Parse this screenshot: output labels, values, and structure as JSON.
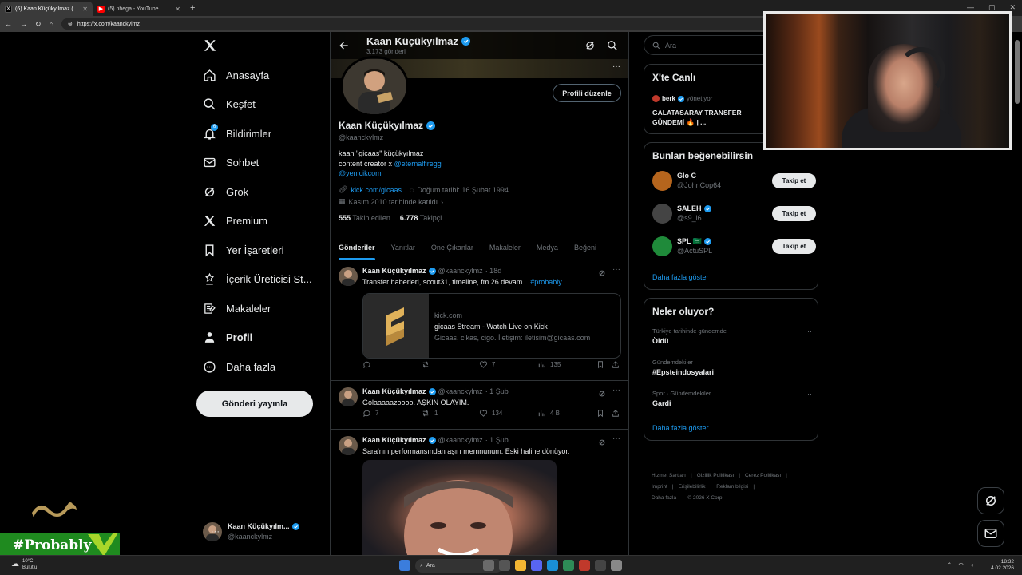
{
  "browser": {
    "tabs": [
      {
        "title": "(6) Kaan Küçükyılmaz (@kaanckylmz) / X",
        "fav": "X",
        "color": "#000000",
        "active": true
      },
      {
        "title": "(5) nhega - YouTube",
        "fav": "▶",
        "color": "#ff0000",
        "active": false
      }
    ],
    "url": "https://x.com/kaanckylmz"
  },
  "nav": {
    "items": [
      {
        "label": "Anasayfa",
        "icon": "home-icon"
      },
      {
        "label": "Keşfet",
        "icon": "search-icon"
      },
      {
        "label": "Bildirimler",
        "icon": "bell-icon",
        "badge": "6"
      },
      {
        "label": "Sohbet",
        "icon": "mail-icon"
      },
      {
        "label": "Grok",
        "icon": "grok-icon"
      },
      {
        "label": "Premium",
        "icon": "x-icon"
      },
      {
        "label": "Yer İşaretleri",
        "icon": "bookmark-icon"
      },
      {
        "label": "İçerik Üreticisi St...",
        "icon": "creator-icon"
      },
      {
        "label": "Makaleler",
        "icon": "articles-icon"
      },
      {
        "label": "Profil",
        "icon": "profile-icon"
      },
      {
        "label": "Daha fazla",
        "icon": "more-circle-icon"
      }
    ],
    "post_button": "Gönderi yayınla",
    "account": {
      "name": "Kaan Küçükyılm...",
      "handle": "@kaanckylmz"
    }
  },
  "profile": {
    "header_name": "Kaan Küçükyılmaz",
    "post_count": "3.173 gönderi",
    "edit_button": "Profili düzenle",
    "name": "Kaan Küçükyılmaz",
    "handle": "@kaanckylmz",
    "bio_line1": "kaan \"gicaas\" küçükyılmaz",
    "bio_line2_prefix": "content creator x ",
    "bio_link1": "@eternalfiregg",
    "bio_link2": "@yenicikcom",
    "website": "kick.com/gicaas",
    "birthday": "Doğum tarihi: 16 Şubat 1994",
    "joined": "Kasım 2010 tarihinde katıldı",
    "following_count": "555",
    "following_label": "Takip edilen",
    "followers_count": "6.778",
    "followers_label": "Takipçi",
    "tabs": [
      "Gönderiler",
      "Yanıtlar",
      "Öne Çıkanlar",
      "Makaleler",
      "Medya",
      "Beğeni"
    ]
  },
  "posts": [
    {
      "name": "Kaan Küçükyılmaz",
      "handle": "@kaanckylmz",
      "time": "· 18d",
      "text": "Transfer haberleri, scout31, timeline, fm 26 devam...",
      "hashtag": "#probably",
      "card": {
        "domain": "kick.com",
        "title": "gicaas Stream - Watch Live on Kick",
        "desc": "Gicaas, cikas, cigo. İletişim: iletisim@gicaas.com"
      },
      "replies": "",
      "reposts": "",
      "likes": "7",
      "views": "135"
    },
    {
      "name": "Kaan Küçükyılmaz",
      "handle": "@kaanckylmz",
      "time": "· 1 Şub",
      "text": "Golaaaaazoooo. AŞKIN OLAYIM.",
      "replies": "7",
      "reposts": "1",
      "likes": "134",
      "views": "4 B"
    },
    {
      "name": "Kaan Küçükyılmaz",
      "handle": "@kaanckylmz",
      "time": "· 1 Şub",
      "text": "Sara'nın performansından aşırı memnunum. Eski haline dönüyor."
    }
  ],
  "sidebar": {
    "search_placeholder": "Ara",
    "live": {
      "title": "X'te Canlı",
      "host": "berk",
      "host_suffix": "yönetiyor",
      "stream_title": "GALATASARAY TRANSFER GÜNDEMİ 🔥 | ..."
    },
    "suggestions": {
      "title": "Bunları beğenebilirsin",
      "users": [
        {
          "name": "Glo C",
          "handle": "@JohnCop64",
          "verified": false
        },
        {
          "name": "SALEH",
          "handle": "@s9_l6",
          "verified": true
        },
        {
          "name": "SPL 🇸🇦",
          "handle": "@ActuSPL",
          "verified": true
        }
      ],
      "follow_label": "Takip et",
      "show_more": "Daha fazla göster"
    },
    "trends": {
      "title": "Neler oluyor?",
      "items": [
        {
          "context": "Türkiye tarihinde gündemde",
          "topic": "Öldü"
        },
        {
          "context": "Gündemdekiler",
          "topic": "#Epsteindosyalari"
        },
        {
          "context": "Spor · Gündemdekiler",
          "topic": "Gardi"
        }
      ],
      "show_more": "Daha fazla göster"
    },
    "footer": [
      "Hizmet Şartları",
      "|",
      "Gizlilik Politikası",
      "|",
      "Çerez Politikası",
      "|",
      "Imprint",
      "|",
      "Erişilebilirlik",
      "|",
      "Reklam bilgisi",
      "|",
      "Daha fazla ···",
      "© 2026 X Corp."
    ]
  },
  "overlay": {
    "brand": "#Probably"
  },
  "taskbar": {
    "weather_temp": "10°C",
    "weather_desc": "Bulutlu",
    "search": "Ara",
    "time": "18:32",
    "date": "4.02.2026"
  },
  "colors": {
    "accent": "#1d9bf0",
    "bg": "#000000",
    "border": "#2f3336",
    "muted": "#71767b",
    "brand_green": "#1f8a1f"
  }
}
